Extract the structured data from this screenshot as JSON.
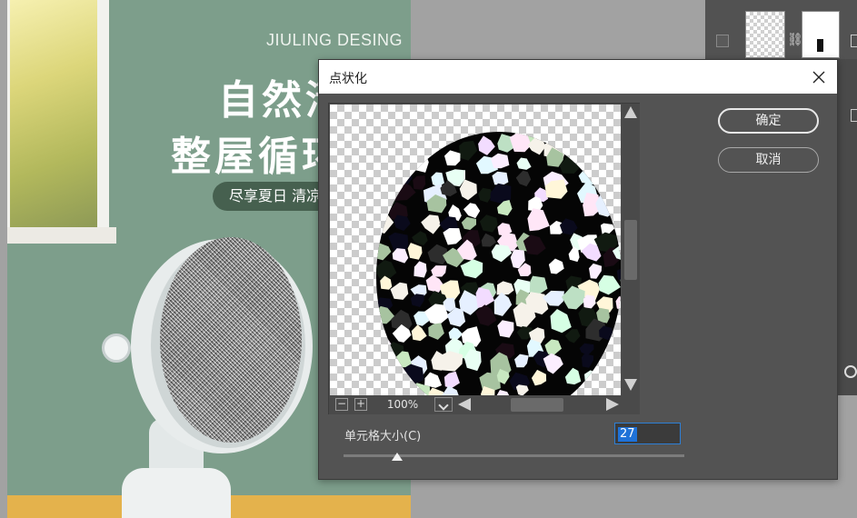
{
  "background": {
    "poster": {
      "brand": "JIULING DESING",
      "title_line1": "自然清",
      "title_line2": "整屋循环",
      "slogan": "尽享夏日 清凉"
    }
  },
  "dialog": {
    "title": "点状化",
    "ok_label": "确定",
    "cancel_label": "取消",
    "zoom_minus": "−",
    "zoom_plus": "+",
    "zoom_value": "100%",
    "param_label": "单元格大小(C)",
    "cell_size": "27",
    "slider_value": 27,
    "slider_min": 3,
    "slider_max": 300
  },
  "colors": {
    "dialog_bg": "#535353",
    "selection": "#1f72d8",
    "preview_checker": "#cccccc"
  }
}
